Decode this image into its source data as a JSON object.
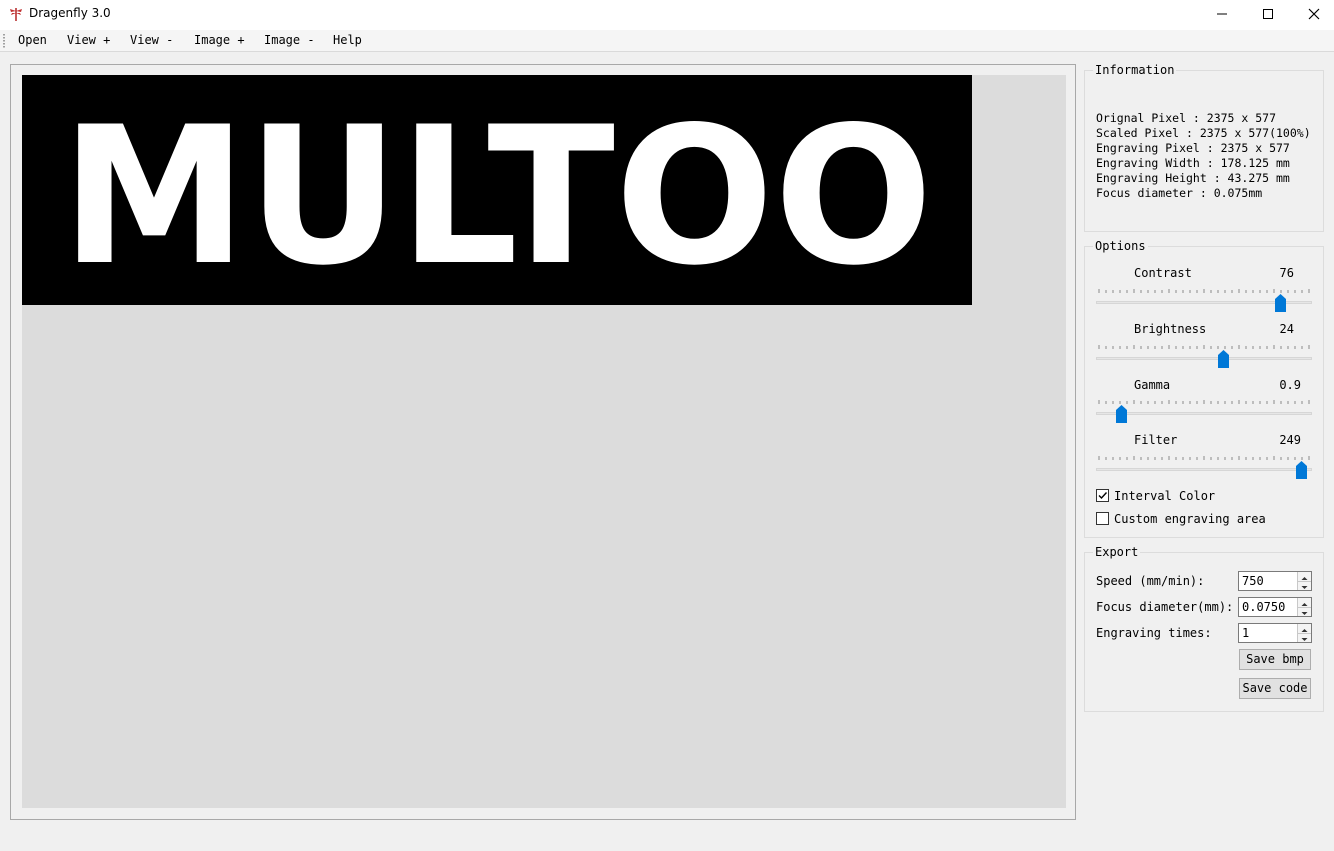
{
  "window": {
    "title": "Dragenfly 3.0",
    "buttons": [
      "minimize-icon",
      "maximize-icon",
      "close-icon"
    ]
  },
  "menu": {
    "items": [
      {
        "label": "Open"
      },
      {
        "label": "View +"
      },
      {
        "label": "View -"
      },
      {
        "label": "Image +"
      },
      {
        "label": "Image -"
      },
      {
        "label": "Help"
      }
    ]
  },
  "preview": {
    "image_text": "MULTOO",
    "background": "#000000",
    "text_color": "#ffffff"
  },
  "information": {
    "title": "Information",
    "lines": [
      "Orignal Pixel : 2375 x 577",
      "Scaled Pixel : 2375 x 577(100%)",
      "Engraving Pixel : 2375 x 577",
      "Engraving Width : 178.125 mm",
      "Engraving Height : 43.275 mm",
      "Focus diameter : 0.075mm"
    ]
  },
  "options": {
    "title": "Options",
    "sliders": [
      {
        "label": "Contrast",
        "value": "76",
        "fraction": 0.87
      },
      {
        "label": "Brightness",
        "value": "24",
        "fraction": 0.59
      },
      {
        "label": "Gamma",
        "value": "0.9",
        "fraction": 0.09
      },
      {
        "label": "Filter",
        "value": "249",
        "fraction": 0.97
      }
    ],
    "checkboxes": [
      {
        "label": "Interval Color",
        "checked": true
      },
      {
        "label": "Custom engraving area",
        "checked": false
      }
    ],
    "accent_color": "#0078d7"
  },
  "export": {
    "title": "Export",
    "fields": [
      {
        "label": "Speed (mm/min):",
        "value": "750"
      },
      {
        "label": "Focus diameter(mm):",
        "value": "0.0750"
      },
      {
        "label": "Engraving times:",
        "value": "1"
      }
    ],
    "save_bmp_label": "Save bmp",
    "save_code_label": "Save code"
  }
}
